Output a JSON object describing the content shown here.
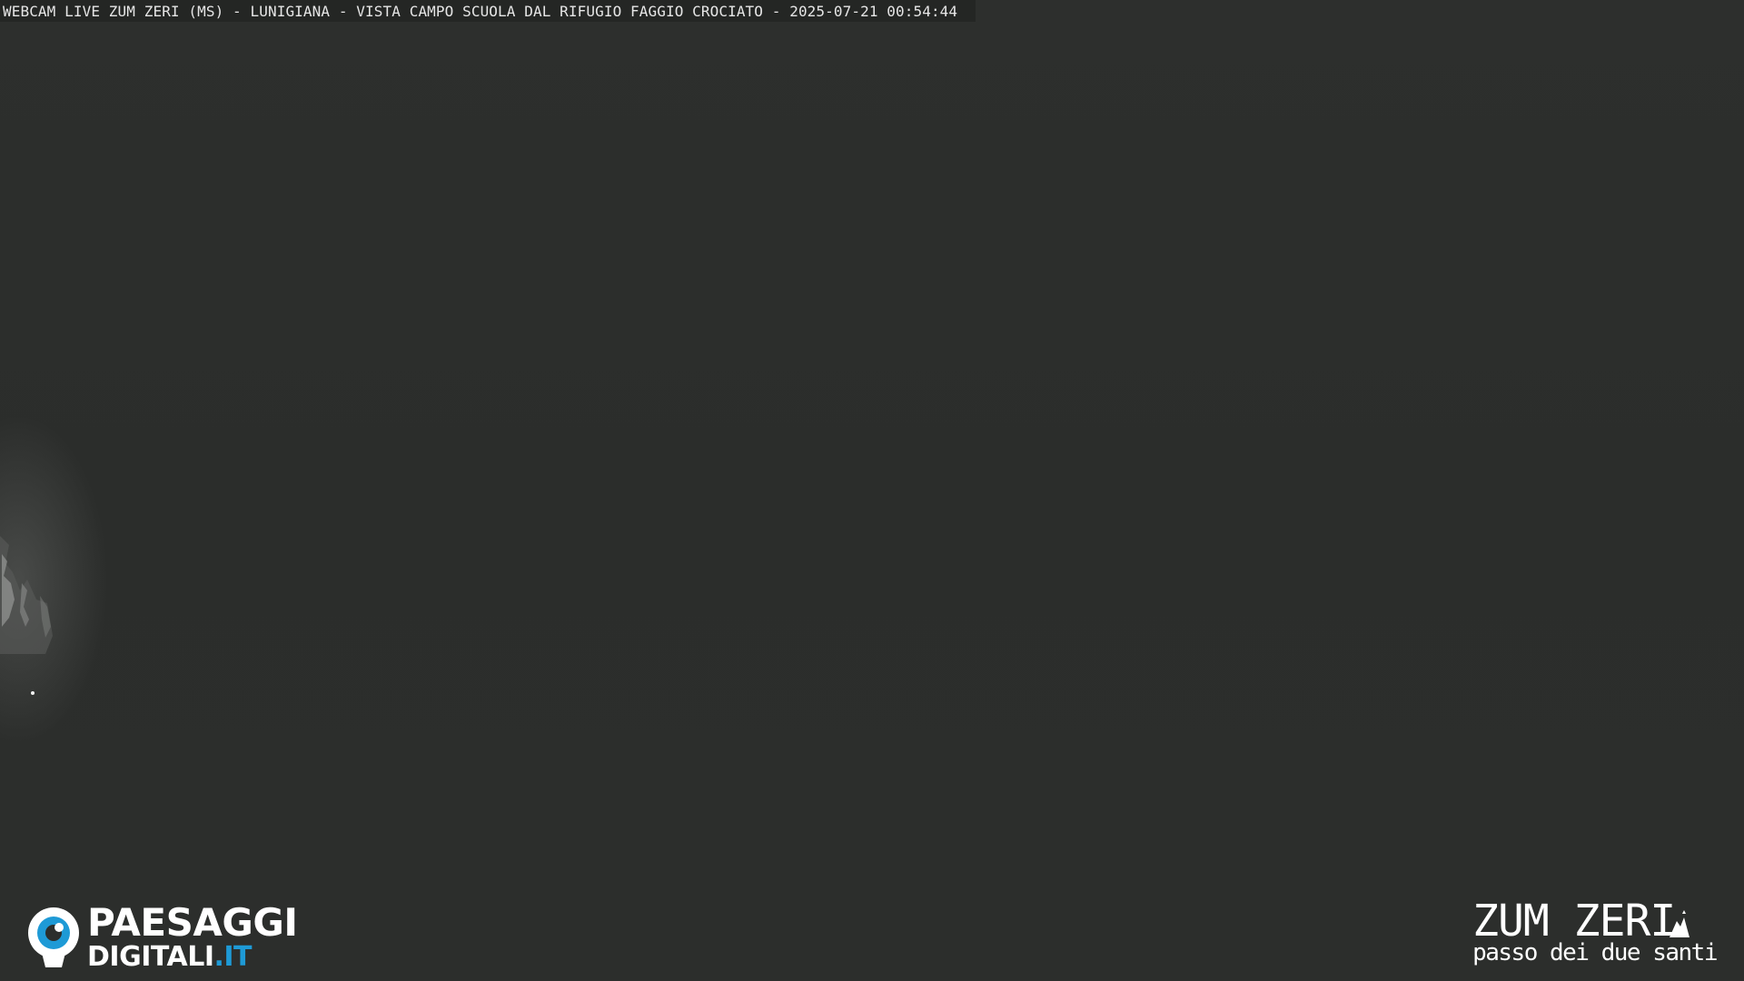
{
  "overlay": {
    "caption": "WEBCAM LIVE ZUM ZERI (MS) - LUNIGIANA - VISTA CAMPO SCUOLA DAL RIFUGIO FAGGIO CROCIATO - 2025-07-21 00:54:44"
  },
  "scene": {
    "background_color": "#2c2e2c"
  },
  "logo_left": {
    "line1": "PAESAGGI",
    "line2_main": "DIGITALI",
    "line2_ext": ".IT",
    "icon": "eye-icon",
    "accent_color": "#1e9ad6"
  },
  "logo_right": {
    "brand": "ZUM ZERI",
    "tagline": "passo dei due santi",
    "icon": "mountain-icon"
  }
}
